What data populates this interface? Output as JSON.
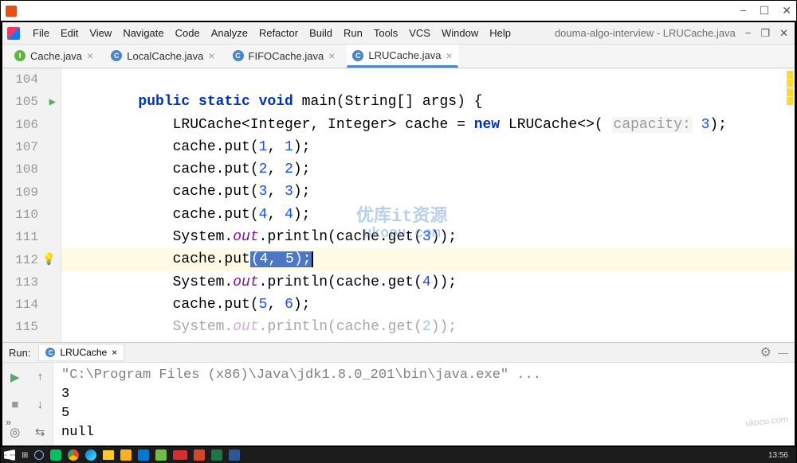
{
  "os": {
    "min": "−",
    "max": "☐",
    "close": "✕"
  },
  "ide": {
    "menu": [
      "File",
      "Edit",
      "View",
      "Navigate",
      "Code",
      "Analyze",
      "Refactor",
      "Build",
      "Run",
      "Tools",
      "VCS",
      "Window",
      "Help"
    ],
    "title": "douma-algo-interview - LRUCache.java",
    "winctrls": {
      "min": "−",
      "restore": "❐",
      "close": "✕"
    }
  },
  "tabs": [
    {
      "icon": "I",
      "iconClass": "type-i",
      "label": "Cache.java",
      "active": false
    },
    {
      "icon": "C",
      "iconClass": "type-c",
      "label": "LocalCache.java",
      "active": false
    },
    {
      "icon": "C",
      "iconClass": "type-c",
      "label": "FIFOCache.java",
      "active": false
    },
    {
      "icon": "C",
      "iconClass": "type-c",
      "label": "LRUCache.java",
      "active": true
    }
  ],
  "editor": {
    "lines": [
      {
        "n": "104",
        "html": ""
      },
      {
        "n": "105",
        "html": "        <span class='kw'>public static void</span> main(String[] args) {",
        "run": true
      },
      {
        "n": "106",
        "html": "            LRUCache&lt;Integer, Integer&gt; cache = <span class='kw'>new</span> LRUCache&lt;&gt;( <span class='param-hint'>capacity:</span> <span class='str-num'>3</span>);"
      },
      {
        "n": "107",
        "html": "            cache.put(<span class='str-num'>1</span>, <span class='str-num'>1</span>);"
      },
      {
        "n": "108",
        "html": "            cache.put(<span class='str-num'>2</span>, <span class='str-num'>2</span>);"
      },
      {
        "n": "109",
        "html": "            cache.put(<span class='str-num'>3</span>, <span class='str-num'>3</span>);"
      },
      {
        "n": "110",
        "html": "            cache.put(<span class='str-num'>4</span>, <span class='str-num'>4</span>);"
      },
      {
        "n": "111",
        "html": "            System.<span class='method-static'>out</span>.println(cache.get(<span class='str-num'>3</span>));"
      },
      {
        "n": "112",
        "html": "            cache.put<span class='sel'>(4, 5);</span><span class='caret'></span>",
        "bulb": true,
        "hl": true
      },
      {
        "n": "113",
        "html": "            System.<span class='method-static'>out</span>.println(cache.get(<span class='str-num'>4</span>));"
      },
      {
        "n": "114",
        "html": "            cache.put(<span class='str-num'>5</span>, <span class='str-num'>6</span>);"
      },
      {
        "n": "115",
        "html": "            System.<span class='method-static'>out</span>.println(cache.get(<span class='str-num'>2</span>));",
        "faded": true
      }
    ],
    "watermark": {
      "line1": "优库it资源",
      "line2": "ukoou.com"
    }
  },
  "run": {
    "label": "Run:",
    "tabName": "LRUCache",
    "tabClose": "×",
    "gear": "⚙",
    "dash": "—",
    "sidebar": [
      "play",
      "up",
      "stop",
      "down",
      "camera",
      "wrap"
    ],
    "output": {
      "cmd": "\"C:\\Program Files (x86)\\Java\\jdk1.8.0_201\\bin\\java.exe\" ...",
      "lines": [
        "3",
        "5",
        "null"
      ]
    },
    "watermark": "ukoou.com"
  },
  "taskbar": {
    "icons": [
      "win",
      "task",
      "cortana",
      "wechat",
      "chrome",
      "edge",
      "folder",
      "pot",
      "mail",
      "camtasia",
      "rec",
      "ppt",
      "excel",
      "word"
    ],
    "time": "13:56"
  }
}
